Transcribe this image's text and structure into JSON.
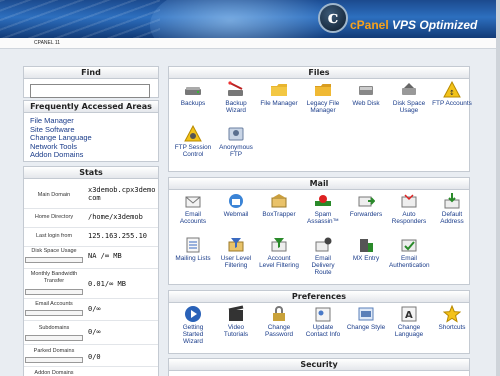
{
  "header": {
    "logo_letter": "c",
    "brand_cp": "cPanel",
    "brand_rest": " VPS Optimized"
  },
  "subbar": {
    "version": "CPANEL 11"
  },
  "find": {
    "title": "Find",
    "placeholder": ""
  },
  "faa": {
    "title": "Frequently Accessed Areas",
    "items": [
      "File Manager",
      "Site Software",
      "Change Language",
      "Network Tools",
      "Addon Domains"
    ]
  },
  "stats": {
    "title": "Stats",
    "rows": [
      {
        "label": "Main Domain",
        "value": "x3demob.cpx3demo\ncom"
      },
      {
        "label": "Home Directory",
        "value": "/home/x3demob"
      },
      {
        "label": "Last login from",
        "value": "125.163.255.10"
      },
      {
        "label": "Disk Space Usage",
        "value": "NA /∞ MB"
      },
      {
        "label": "Monthly Bandwidth Transfer",
        "value": "0.01/∞ MB"
      },
      {
        "label": "Email Accounts",
        "value": "0/∞"
      },
      {
        "label": "Subdomains",
        "value": "0/∞"
      },
      {
        "label": "Parked Domains",
        "value": "0/0"
      },
      {
        "label": "Addon Domains",
        "value": ""
      }
    ]
  },
  "files": {
    "title": "Files",
    "items": [
      "Backups",
      "Backup Wizard",
      "File Manager",
      "Legacy File Manager",
      "Web Disk",
      "Disk Space Usage",
      "FTP Accounts",
      "FTP Session Control",
      "Anonymous FTP"
    ]
  },
  "mail": {
    "title": "Mail",
    "items": [
      "Email Accounts",
      "Webmail",
      "BoxTrapper",
      "Spam Assassin™",
      "Forwarders",
      "Auto Responders",
      "Default Address",
      "Mailing Lists",
      "User Level Filtering",
      "Account Level Filtering",
      "Email Delivery Route",
      "MX Entry",
      "Email Authentication"
    ]
  },
  "prefs": {
    "title": "Preferences",
    "items": [
      "Getting Started Wizard",
      "Video Tutorials",
      "Change Password",
      "Update Contact Info",
      "Change Style",
      "Change Language",
      "Shortcuts"
    ]
  },
  "security": {
    "title": "Security"
  }
}
